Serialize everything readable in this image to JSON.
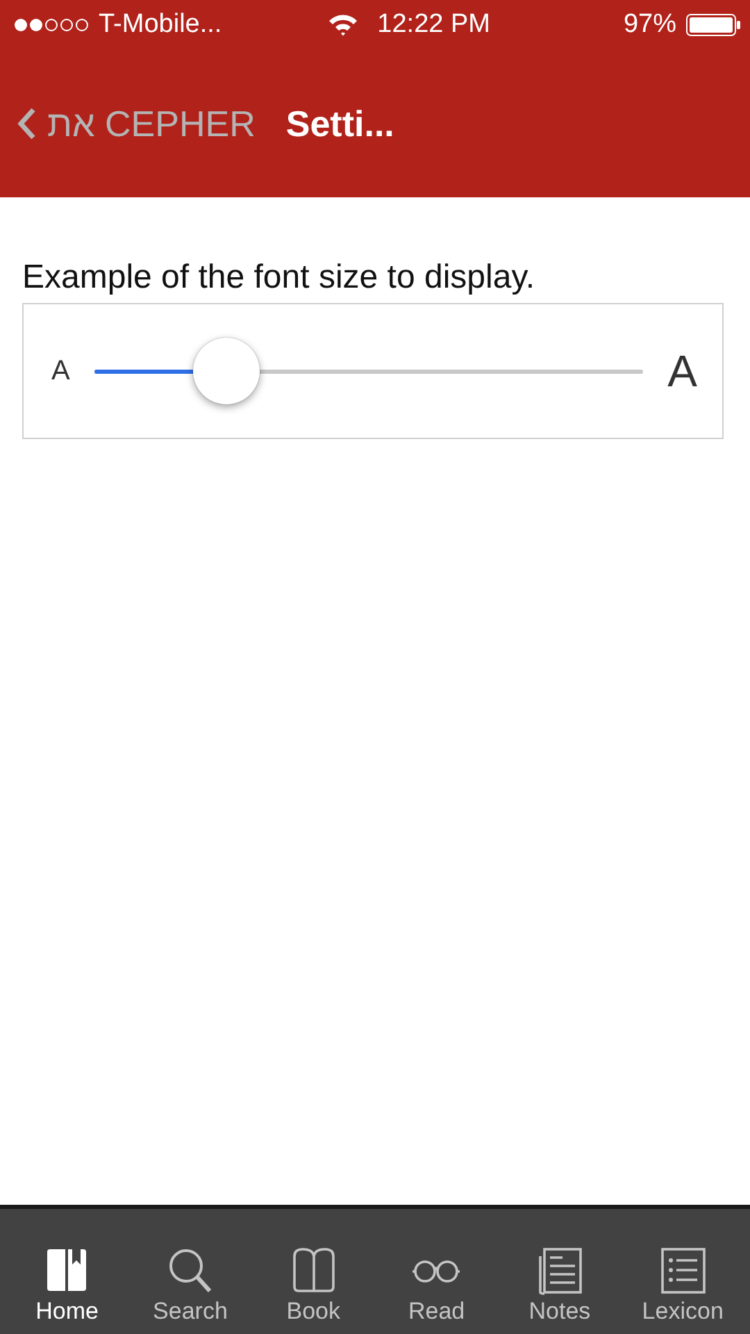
{
  "status_bar": {
    "carrier": "T-Mobile...",
    "time": "12:22 PM",
    "battery": "97%"
  },
  "nav_bar": {
    "back_label": "את CEPHER",
    "title": "Setti..."
  },
  "font_size": {
    "caption": "Example of the font size to display.",
    "small_label": "A",
    "large_label": "A",
    "level": 0.24
  },
  "tab_bar": [
    {
      "label": "Home",
      "selected": true
    },
    {
      "label": "Search",
      "selected": false
    },
    {
      "label": "Book",
      "selected": false
    },
    {
      "label": "Read",
      "selected": false
    },
    {
      "label": "Notes",
      "selected": false
    },
    {
      "label": "Lexicon",
      "selected": false
    }
  ]
}
